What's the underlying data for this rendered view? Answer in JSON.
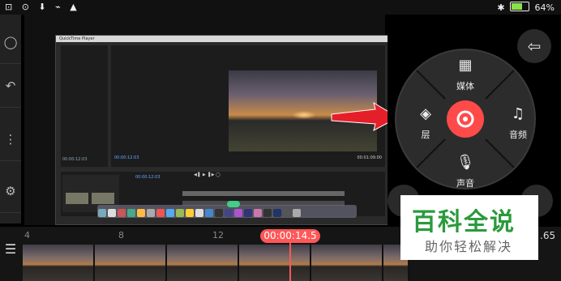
{
  "status_bar": {
    "left_icons": "⊡ ⊙ ⬇ ⌁ ▲",
    "battery_percent": "64%",
    "battery_level": 0.64
  },
  "preview": {
    "app_title": "QuickTime Player",
    "timecode_left": "00:00:12:03",
    "timecode_right": "00:01:09:00",
    "timeline_timecode": "00:00:12:03"
  },
  "wheel": {
    "media_label": "媒体",
    "layer_label": "层",
    "audio_label": "音频",
    "voice_label": "声音",
    "record_color": "#ff4a4a"
  },
  "timeline": {
    "ruler_ticks": [
      "4",
      "8",
      "12"
    ],
    "playhead_time": "00:00:14.5",
    "right_number": ".65"
  },
  "watermark": {
    "title": "百科全说",
    "subtitle": "助你轻松解决"
  },
  "colors": {
    "accent": "#ff5757",
    "watermark_green": "#2a9a3c"
  }
}
